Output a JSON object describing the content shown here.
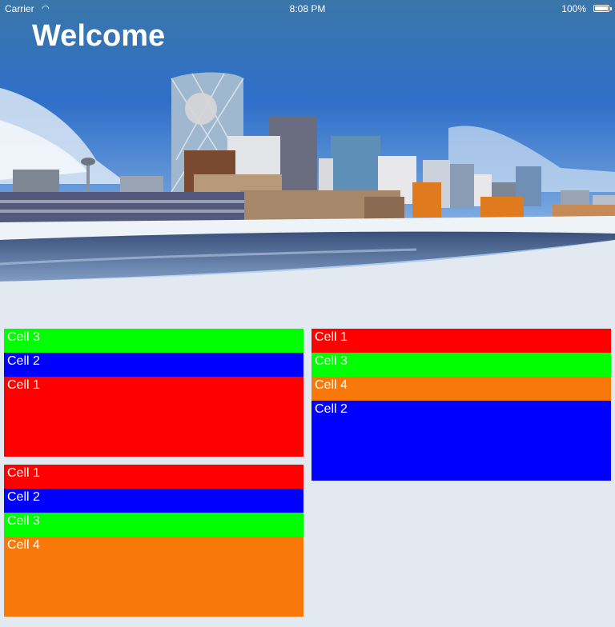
{
  "status_bar": {
    "carrier": "Carrier",
    "time": "8:08 PM",
    "battery": "100%"
  },
  "title": "Welcome",
  "colors": {
    "red": "#ff0000",
    "green": "#00ff00",
    "blue": "#0000ff",
    "orange": "#f8790a",
    "background": "#e3e9f1"
  },
  "grids": {
    "left_top": [
      "Cell 3",
      "Cell 2",
      "Cell 1"
    ],
    "left_bottom": [
      "Cell 1",
      "Cell 2",
      "Cell 3",
      "Cell 4"
    ],
    "right_top": [
      "Cell 1",
      "Cell 3",
      "Cell 4",
      "Cell 2"
    ]
  }
}
